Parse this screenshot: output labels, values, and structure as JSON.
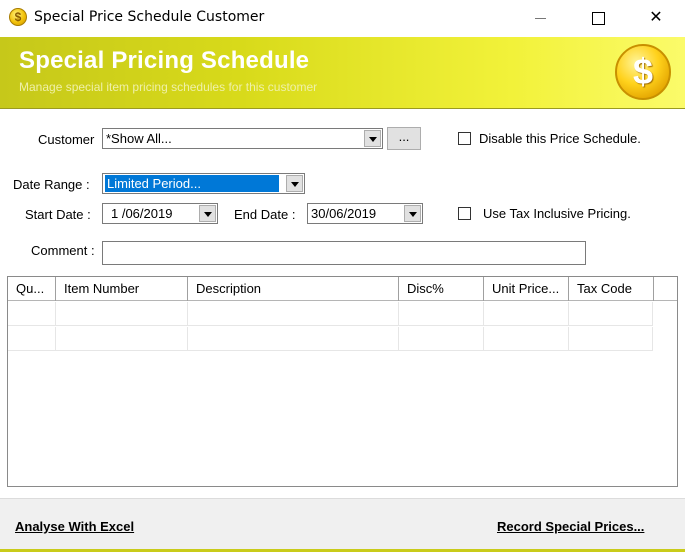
{
  "window": {
    "title": "Special Price Schedule Customer",
    "close_glyph": "✕"
  },
  "banner": {
    "title": "Special Pricing Schedule",
    "subtitle": "Manage special item pricing schedules for this customer",
    "icon": "dollar-coin-icon",
    "coin_glyph": "$"
  },
  "form": {
    "customer_label": "Customer",
    "customer_value": "*Show All...",
    "browse_label": "...",
    "disable_label": "Disable this Price Schedule.",
    "disable_checked": false,
    "date_range_label": "Date Range :",
    "date_range_value": "Limited Period...",
    "start_date_label": "Start Date :",
    "start_date_value": "1 /06/2019",
    "end_date_label": "End Date :",
    "end_date_value": "30/06/2019",
    "tax_inclusive_label": "Use Tax Inclusive Pricing.",
    "tax_inclusive_checked": false,
    "comment_label": "Comment :",
    "comment_value": ""
  },
  "grid": {
    "columns": [
      "Qu...",
      "Item Number",
      "Description",
      "Disc%",
      "Unit Price...",
      "Tax Code"
    ],
    "rows": [
      [
        "",
        "",
        "",
        "",
        "",
        ""
      ],
      [
        "",
        "",
        "",
        "",
        "",
        ""
      ]
    ]
  },
  "footer": {
    "analyse_label": "Analyse With Excel",
    "record_label": "Record Special Prices..."
  },
  "colors": {
    "banner_accent": "#d8da1a",
    "selection": "#0078d7"
  }
}
